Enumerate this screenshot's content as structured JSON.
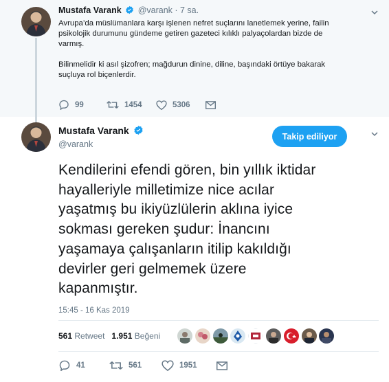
{
  "parent_tweet": {
    "author_name": "Mustafa Varank",
    "handle_time": "@varank · 7 sa.",
    "paragraph1": [
      "Avrupa’da müslümanlara karşı işlenen nefret suçlarını lanetlemek yerine, failin",
      "psikolojik durumunu gündeme getiren gazeteci kılıklı palyaçolardan bizde de",
      "varmış."
    ],
    "paragraph2": [
      "Bilinmelidir ki asıl şizofren; mağdurun dinine, diline, başındaki örtüye bakarak",
      "suçluya rol biçenlerdir."
    ],
    "replies": "99",
    "retweets": "1454",
    "likes": "5306"
  },
  "main_tweet": {
    "author_name": "Mustafa Varank",
    "handle": "@varank",
    "follow_label": "Takip ediliyor",
    "text_lines": [
      "Kendilerini efendi gören, bin yıllık iktidar",
      "hayalleriyle milletimize nice acılar",
      "yaşatmış bu ikiyüzlülerin aklına iyice",
      "sokması gereken şudur: İnancını",
      "yaşamaya çalışanların itilip kakıldığı",
      "devirler geri gelmemek üzere",
      "kapanmıştır."
    ],
    "timestamp": "15:45 - 16 Kas 2019",
    "retweet_count": "561",
    "retweet_label": "Retweet",
    "like_count": "1.951",
    "like_label": "Beğeni",
    "replies": "41",
    "retweets": "561",
    "likes": "1951"
  },
  "colors": {
    "accent": "#1da1f2",
    "muted": "#657786",
    "parent_bg": "#f5f8fa",
    "thread_line": "#ccd6dd"
  },
  "icons": [
    "verified-badge-icon",
    "chevron-down-icon",
    "reply-icon",
    "retweet-icon",
    "heart-icon",
    "envelope-icon"
  ]
}
